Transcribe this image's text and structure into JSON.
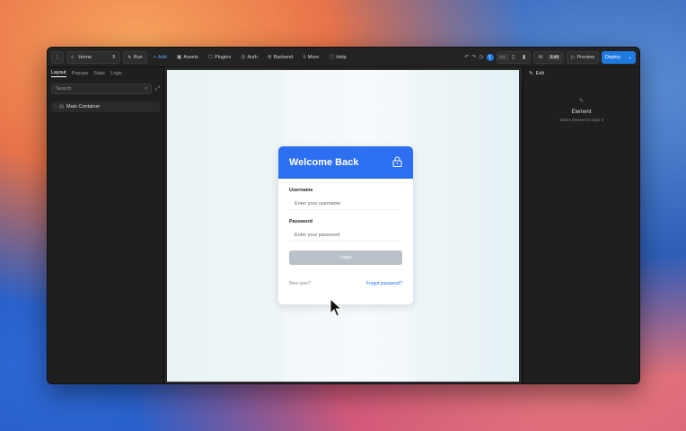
{
  "toolbar": {
    "page_select": "Home",
    "run": "Run",
    "add": "Add",
    "assets": "Assets",
    "plugins": "Plugins",
    "auth": "Auth",
    "backend": "Backend",
    "more": "More",
    "help": "Help",
    "notification_count": "1",
    "ai": "AI",
    "edit": "Edit",
    "preview": "Preview",
    "deploy": "Deploy"
  },
  "left_panel": {
    "tabs": [
      "Layout",
      "Popups",
      "State",
      "Logic"
    ],
    "search_placeholder": "Search",
    "tree_root": "Main Container"
  },
  "login_card": {
    "title": "Welcome Back",
    "username_label": "Username",
    "username_placeholder": "Enter your username",
    "password_label": "Password",
    "password_placeholder": "Enter your password",
    "login_button": "Login",
    "new_user": "New user?",
    "forgot_password": "Forgot password?",
    "header_color": "#2c6ff0"
  },
  "right_panel": {
    "header": "Edit",
    "empty_title": "Element",
    "empty_sub": "Select element to style it"
  }
}
